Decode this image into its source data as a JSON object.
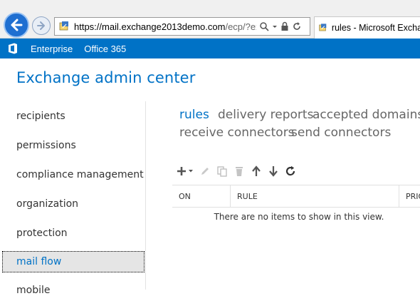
{
  "browser": {
    "url_host": "https://mail.exchange2013demo.com",
    "url_rest": "/ecp/?exsvur",
    "tab_title": "rules - Microsoft Exchan"
  },
  "suite_bar": {
    "links": [
      "Enterprise",
      "Office 365"
    ],
    "color": "#0072c6"
  },
  "app": {
    "title": "Exchange admin center"
  },
  "left_nav": {
    "items": [
      "recipients",
      "permissions",
      "compliance management",
      "organization",
      "protection",
      "mail flow",
      "mobile"
    ],
    "selected": "mail flow"
  },
  "sub_tabs": {
    "items": [
      "rules",
      "delivery reports",
      "accepted domains",
      "receive connectors",
      "send connectors"
    ],
    "active": "rules"
  },
  "toolbar": {
    "icons": [
      "add-icon",
      "edit-icon",
      "copy-icon",
      "delete-icon",
      "move-up-icon",
      "move-down-icon",
      "refresh-icon"
    ]
  },
  "grid": {
    "columns": [
      "ON",
      "RULE",
      "PRIORITY"
    ],
    "empty_message": "There are no items to show in this view."
  }
}
